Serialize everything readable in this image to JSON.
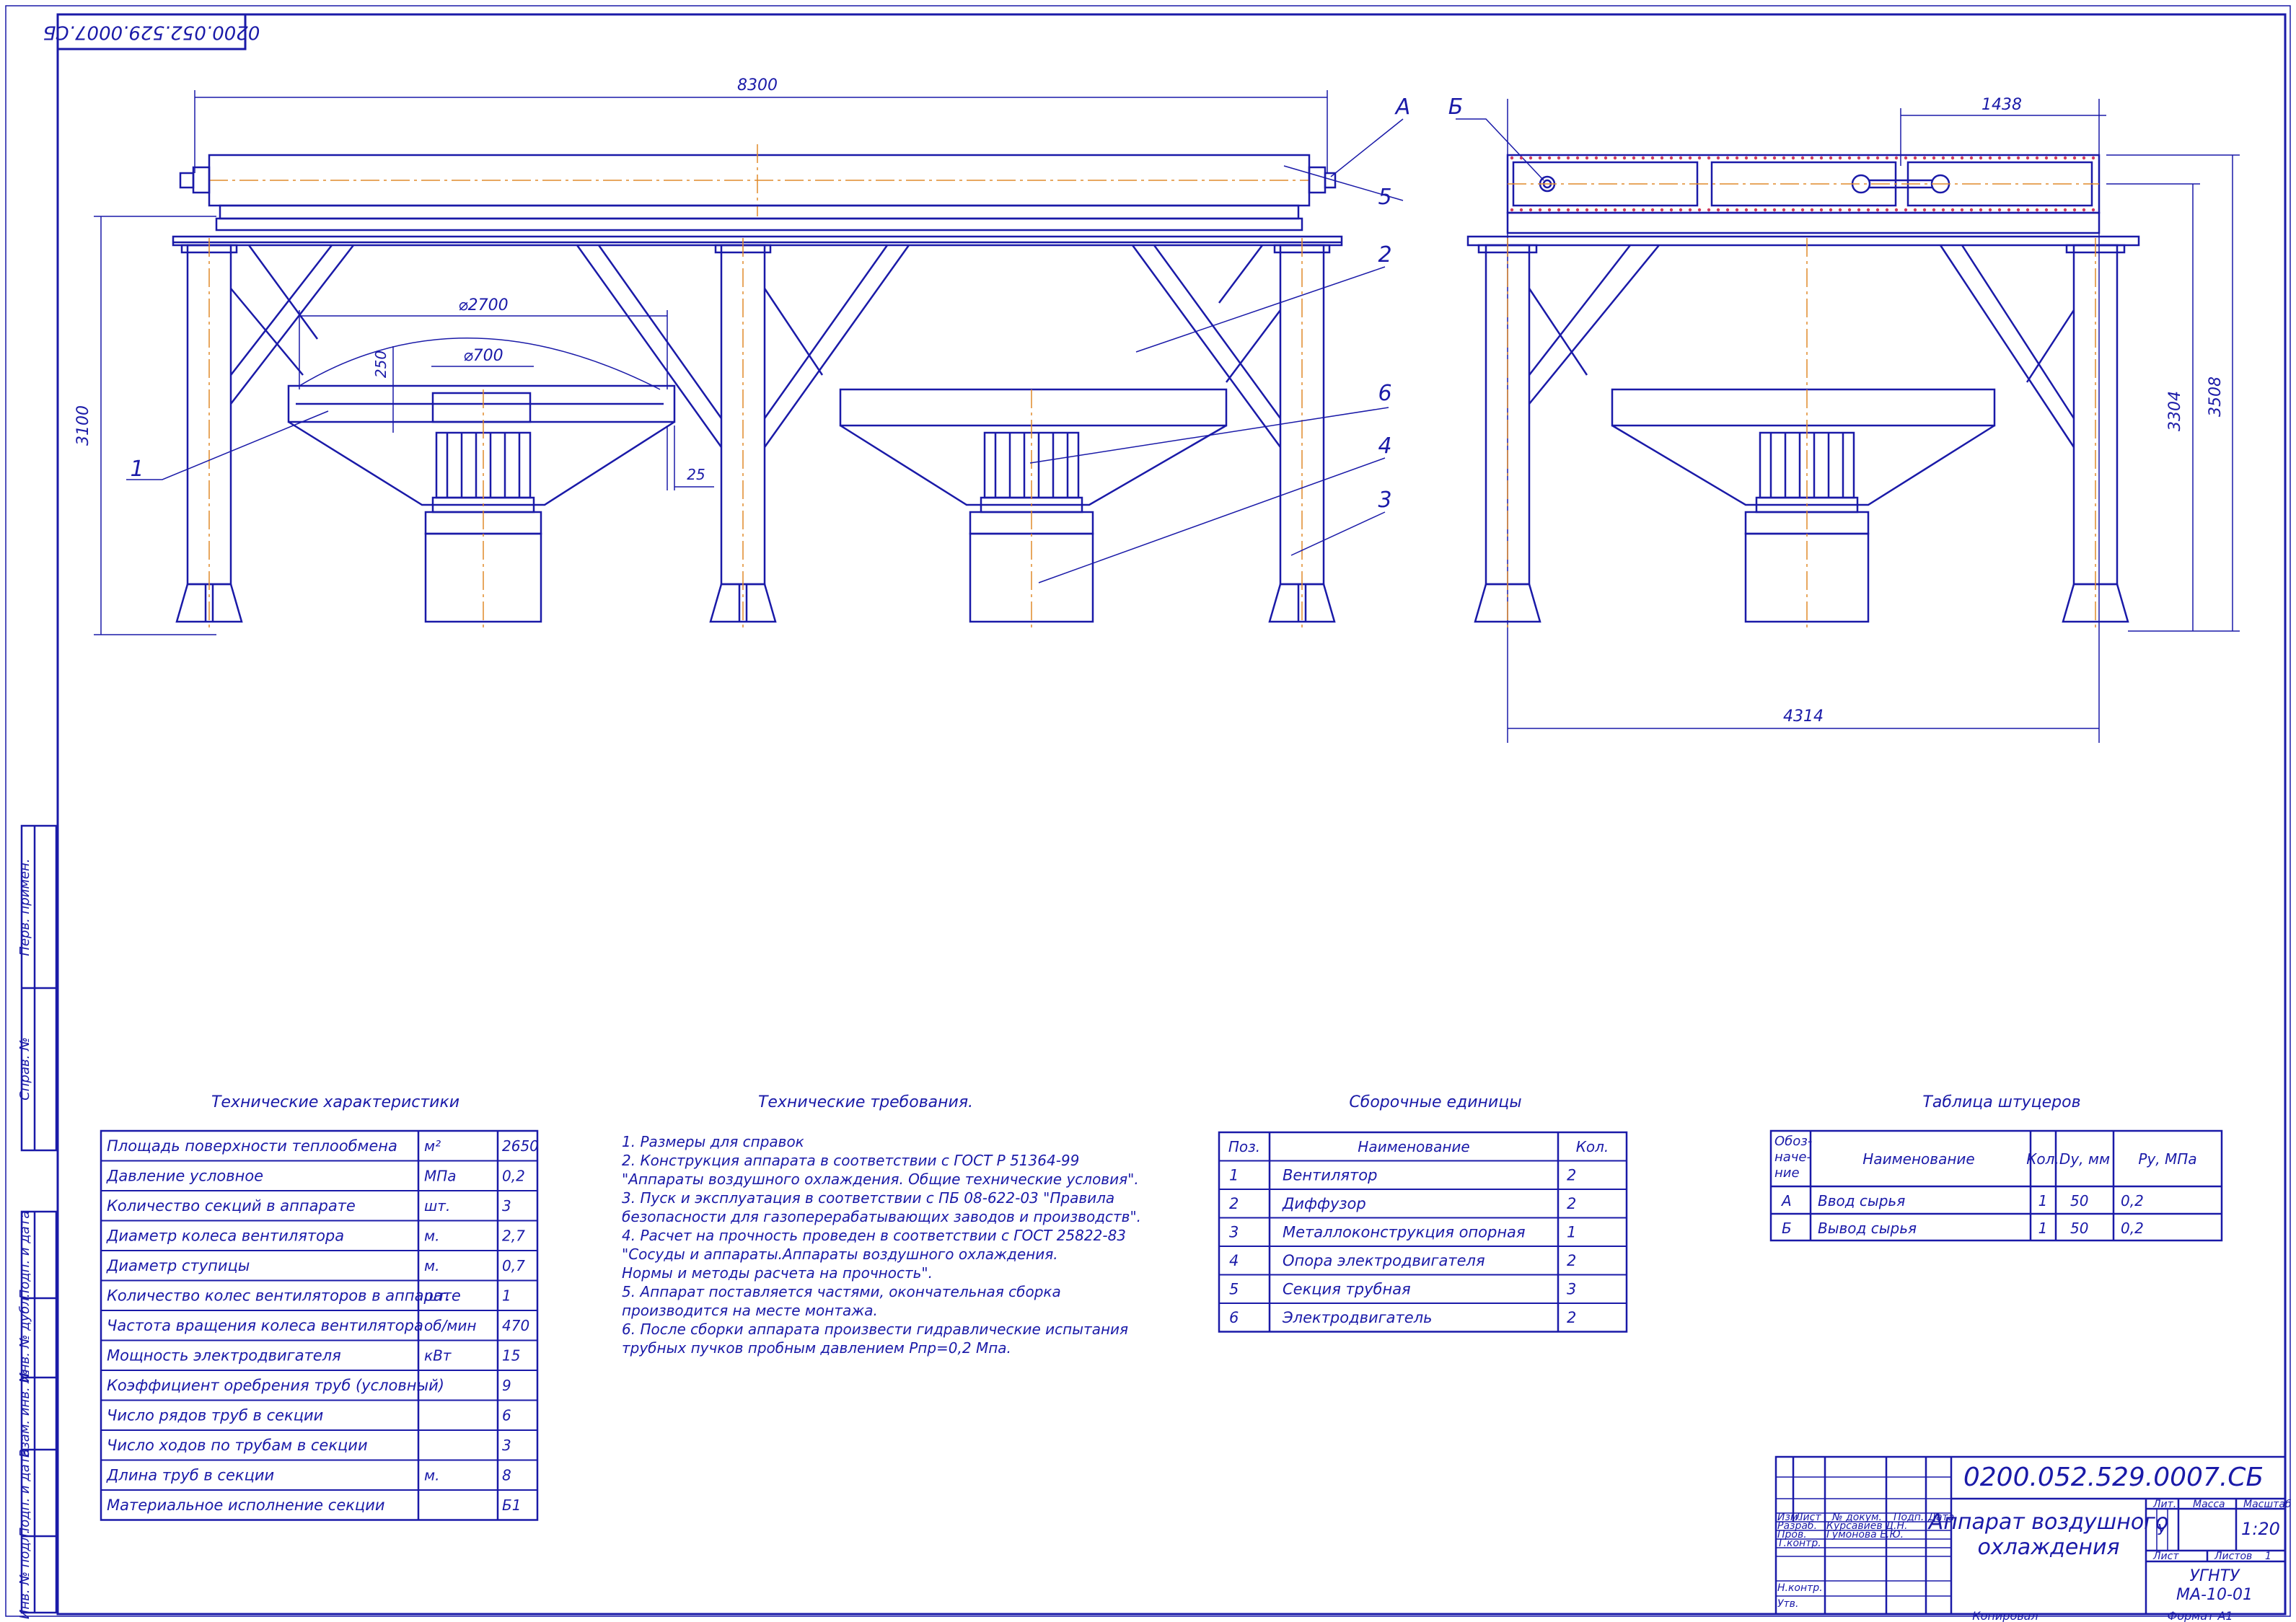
{
  "sheet": {
    "code": "0200.052.529.0007.СБ",
    "code_rotated": "0200.052.529.0007.СБ",
    "title_line1": "Аппарат воздушного",
    "title_line2": "охлаждения",
    "scale": "1:20",
    "lit": "У",
    "sheet_label": "Лист",
    "sheets_label": "Листов",
    "sheets_value": "1",
    "org": "УГНТУ",
    "group": "МА-10-01",
    "copied": "Копировал",
    "format": "Формат   А1",
    "hdr_izm": "Изм.",
    "hdr_list": "Лист",
    "hdr_doc": "№ докум.",
    "hdr_sign": "Подп.",
    "hdr_date": "Дата",
    "hdr_lit": "Лит.",
    "hdr_mass": "Масса",
    "hdr_scale": "Масштаб",
    "role_dev": "Разраб.",
    "role_check": "Пров.",
    "role_tk": "Т.контр.",
    "role_nk": "Н.контр.",
    "role_appr": "Утв.",
    "name_dev": "Курсавиев Д.Н.",
    "name_check": "Гумонова Е.Ю."
  },
  "side_stamps": [
    "Перв. примен.",
    "Справ. №",
    "Подп. и дата",
    "Инв. № дубл.",
    "Взам. инв. №",
    "Подп. и дата",
    "Инв. № подл."
  ],
  "dimensions": {
    "length": "8300",
    "height_left": "3100",
    "wheel_dia": "⌀2700",
    "hub_dia": "⌀700",
    "gap_250": "250",
    "gap_25": "25",
    "pitch": "1438",
    "h3304": "3304",
    "h3508": "3508",
    "width": "4314"
  },
  "labels": {
    "A": "А",
    "B": "Б",
    "p1": "1",
    "p2": "2",
    "p3": "3",
    "p4": "4",
    "p5": "5",
    "p6": "6"
  },
  "tech_char": {
    "title": "Технические характеристики",
    "rows": [
      [
        "Площадь поверхности теплообмена",
        "м²",
        "2650"
      ],
      [
        "Давление условное",
        "МПа",
        "0,2"
      ],
      [
        "Количество секций в аппарате",
        "шт.",
        "3"
      ],
      [
        "Диаметр колеса вентилятора",
        "м.",
        "2,7"
      ],
      [
        "Диаметр ступицы",
        "м.",
        "0,7"
      ],
      [
        "Количество колес вентиляторов в аппарате",
        "шт.",
        "1"
      ],
      [
        "Частота вращения колеса вентилятора",
        "об/мин",
        "470"
      ],
      [
        "Мощность электродвигателя",
        "кВт",
        "15"
      ],
      [
        "Коэффициент оребрения труб (условный)",
        "",
        "9"
      ],
      [
        "Число рядов труб в секции",
        "",
        "6"
      ],
      [
        "Число ходов по трубам в секции",
        "",
        "3"
      ],
      [
        "Длина труб в секции",
        "м.",
        "8"
      ],
      [
        "Материальное исполнение секции",
        "",
        "Б1"
      ]
    ]
  },
  "tech_req": {
    "title": "Технические требования.",
    "lines": [
      "1. Размеры для справок",
      "2. Конструкция аппарата в соответствии с ГОСТ Р 51364-99",
      "   \"Аппараты воздушного охлаждения. Общие технические условия\".",
      "3. Пуск и эксплуатация в соответствии с ПБ 08-622-03 \"Правила",
      "   безопасности для газоперерабатывающих заводов и производств\".",
      "4. Расчет на прочность проведен в соответствии с ГОСТ 25822-83",
      "   \"Сосуды и аппараты.Аппараты воздушного охлаждения.",
      "   Нормы и методы расчета на прочность\".",
      "5. Аппарат поставляется частями, окончательная сборка",
      "   производится на месте монтажа.",
      "6. После сборки аппарата произвести гидравлические испытания",
      "   трубных пучков пробным давлением Pпр=0,2 Мпа."
    ]
  },
  "assembly": {
    "title": "Сборочные единицы",
    "headers": [
      "Поз.",
      "Наименование",
      "Кол."
    ],
    "rows": [
      [
        "1",
        "Вентилятор",
        "2"
      ],
      [
        "2",
        "Диффузор",
        "2"
      ],
      [
        "3",
        "Металлоконструкция опорная",
        "1"
      ],
      [
        "4",
        "Опора электродвигателя",
        "2"
      ],
      [
        "5",
        "Секция трубная",
        "3"
      ],
      [
        "6",
        "Электродвигатель",
        "2"
      ]
    ]
  },
  "nozzles": {
    "title": "Таблица штуцеров",
    "h_designation": "Обоз-наче-ние",
    "h_name": "Наименование",
    "h_qty": "Кол.",
    "h_dn": "Dу, мм",
    "h_p": "Pу, МПа",
    "rows": [
      [
        "А",
        "Ввод сырья",
        "1",
        "50",
        "0,2"
      ],
      [
        "Б",
        "Вывод сырья",
        "1",
        "50",
        "0,2"
      ]
    ]
  }
}
